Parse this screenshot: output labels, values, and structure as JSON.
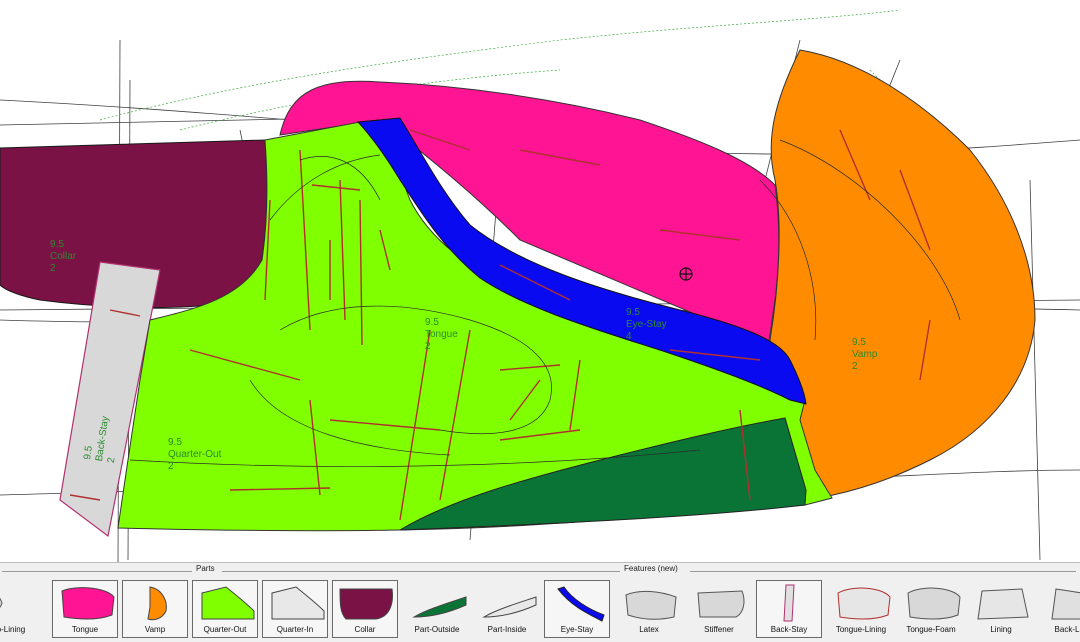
{
  "canvas": {
    "labels": {
      "collar": [
        "9.5",
        "Collar",
        "2"
      ],
      "tongue": [
        "9.5",
        "Tongue",
        "2"
      ],
      "eyestay": [
        "9.5",
        "Eye-Stay",
        "4"
      ],
      "vamp": [
        "9.5",
        "Vamp",
        "2"
      ],
      "quarter_out": [
        "9.5",
        "Quarter-Out",
        "2"
      ],
      "back_stay": [
        "9.5",
        "Back-Stay",
        "2"
      ]
    },
    "colors": {
      "tongue": "#ff1493",
      "vamp": "#ff8c00",
      "quarter_out": "#80ff00",
      "collar": "#7a1245",
      "part_outside": "#0a7437",
      "eye_stay": "#0a0af0",
      "back_stay": "#d8d8d8",
      "stitch": "#b03030",
      "label_text": "#2c8a2c"
    }
  },
  "palette": {
    "parts_header": "Parts",
    "features_header": "Features (new)",
    "items": [
      {
        "label": "Vamp-Lining",
        "icon": "vamp-lining-icon",
        "selected": false
      },
      {
        "label": "Tongue",
        "icon": "tongue-icon",
        "selected": true
      },
      {
        "label": "Vamp",
        "icon": "vamp-icon",
        "selected": true
      },
      {
        "label": "Quarter-Out",
        "icon": "quarter-out-icon",
        "selected": true
      },
      {
        "label": "Quarter-In",
        "icon": "quarter-in-icon",
        "selected": true
      },
      {
        "label": "Collar",
        "icon": "collar-icon",
        "selected": true
      },
      {
        "label": "Part-Outside",
        "icon": "part-outside-icon",
        "selected": false
      },
      {
        "label": "Part-Inside",
        "icon": "part-inside-icon",
        "selected": false
      },
      {
        "label": "Eye-Stay",
        "icon": "eye-stay-icon",
        "selected": true
      },
      {
        "label": "Latex",
        "icon": "latex-icon",
        "selected": false
      },
      {
        "label": "Stiffener",
        "icon": "stiffener-icon",
        "selected": false
      },
      {
        "label": "Back-Stay",
        "icon": "back-stay-icon",
        "selected": true
      },
      {
        "label": "Tongue-Lining",
        "icon": "tongue-lining-icon",
        "selected": false
      },
      {
        "label": "Tongue-Foam",
        "icon": "tongue-foam-icon",
        "selected": false
      },
      {
        "label": "Lining",
        "icon": "lining-icon",
        "selected": false
      },
      {
        "label": "Back-Lini",
        "icon": "back-lining-icon",
        "selected": false
      }
    ]
  }
}
